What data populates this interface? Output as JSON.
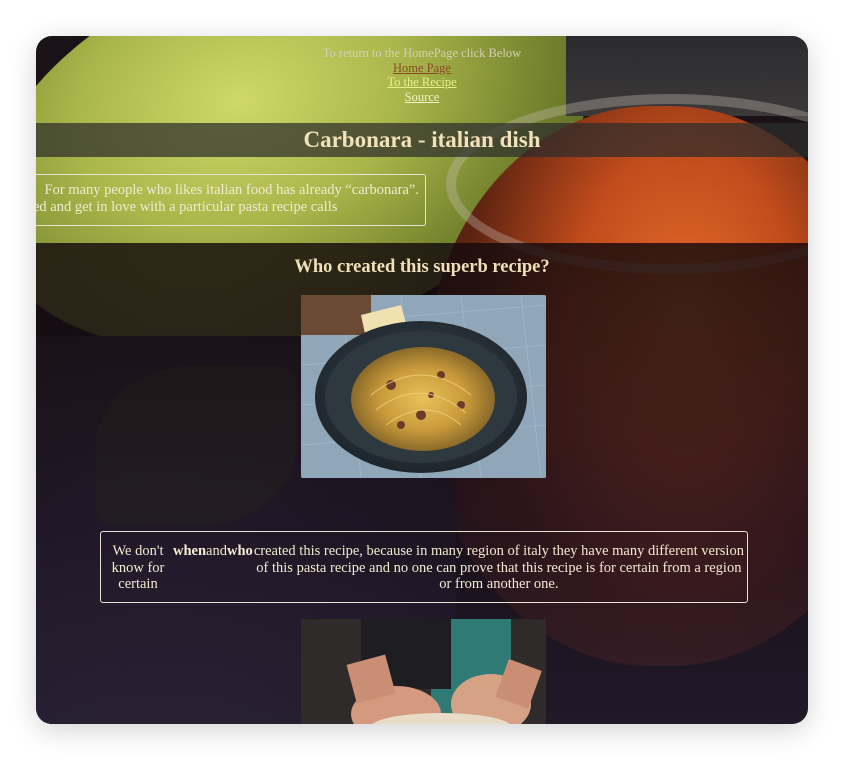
{
  "nav": {
    "intro_text": "To return to the HomePage click Below",
    "home_link": "Home Page",
    "recipe_link": "To the Recipe",
    "source_link": "Source"
  },
  "title": "Carbonara - italian dish",
  "intro_box": {
    "line1": "For many people who likes italian food has already   “carbonara”.",
    "line2": "ed and get in love with a particular pasta recipe calls"
  },
  "question": "Who created this superb recipe?",
  "info": {
    "left_text": "We don't know for certain",
    "word_when": "when",
    "word_and": "and",
    "word_who": "who",
    "right_text": "created this recipe, because in many region of italy they have many different version of this pasta recipe and no one can prove that this recipe is for certain from a region or from another one."
  },
  "colors": {
    "title": "#f2e2b8",
    "link_home": "#8a4a2a",
    "link_recipe": "#eaf08a",
    "border": "#e9e2d2"
  },
  "images": {
    "photo1": "carbonara-plate-photo",
    "photo2": "hands-kneading-dough-photo"
  }
}
